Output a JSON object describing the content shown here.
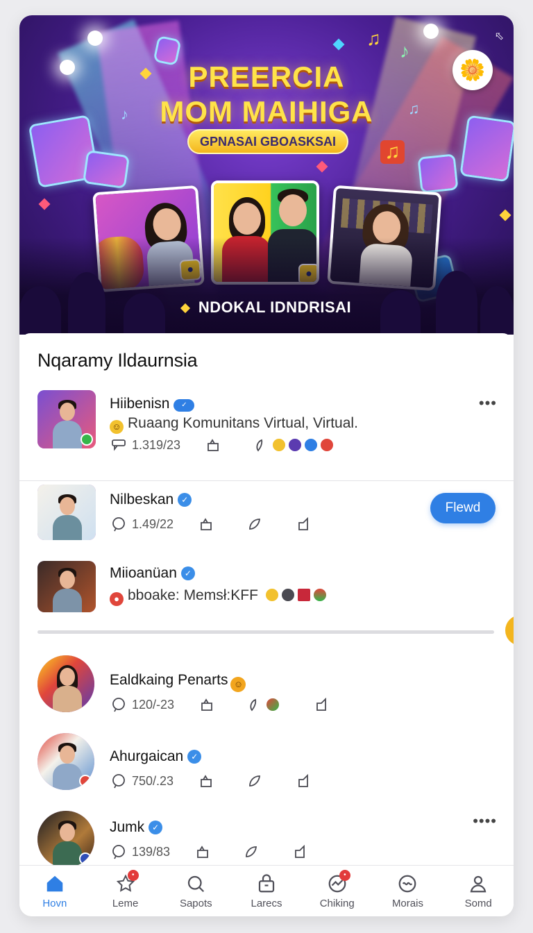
{
  "banner": {
    "title_line1": "PREERCIA",
    "title_line2": "MOM MAIHIGA",
    "pill_text": "GPNASAI GBOASKSAI",
    "footer_text": "NDOKAL IDNDRISAI",
    "colors": {
      "title": "#ffe34a",
      "pill": "#f4b51d",
      "background": "#4a1f93"
    }
  },
  "list": {
    "title": "Nqaramy Ildaurnsia",
    "items": [
      {
        "name": "Hiibenisn",
        "subtitle": "Ruaang Komunitans Virtual, Virtual.",
        "stat": "1.319/23",
        "avatar_icon": "group-avatar"
      },
      {
        "name": "Nilbeskan",
        "stat": "1.49/22",
        "action_label": "Flewd"
      },
      {
        "name": "Miioanüan",
        "subtitle": "bboake: Memsł:KFF"
      },
      {
        "name": "Ealdkaing Penarts",
        "stat": "120/-23"
      },
      {
        "name": "Ahurgaican",
        "stat": "750/.23"
      },
      {
        "name": "Jumk",
        "stat": "139/83"
      }
    ]
  },
  "nav": {
    "items": [
      {
        "label": "Hovn",
        "icon": "home-icon",
        "active": true
      },
      {
        "label": "Leme",
        "icon": "star-icon",
        "badge": true
      },
      {
        "label": "Sapots",
        "icon": "search-icon"
      },
      {
        "label": "Larecs",
        "icon": "lock-icon"
      },
      {
        "label": "Chiking",
        "icon": "activity-icon",
        "badge": true
      },
      {
        "label": "Morais",
        "icon": "smiley-icon"
      },
      {
        "label": "Somd",
        "icon": "profile-icon"
      }
    ],
    "active_color": "#2f7fe4"
  },
  "accent_color": "#2f7fe4"
}
